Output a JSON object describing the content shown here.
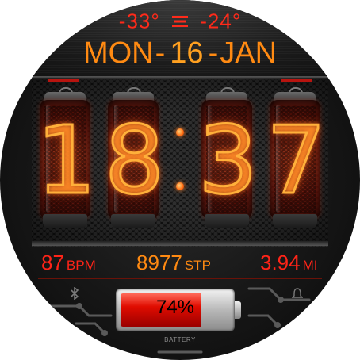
{
  "weather": {
    "temp_low": "-33°",
    "temp_high": "-24°",
    "icon": "wind-icon",
    "color": "#ff2a1a"
  },
  "date": {
    "weekday": "MON",
    "day": "16",
    "month": "JAN",
    "separator": "-",
    "color": "#ff8a12"
  },
  "time": {
    "digits": [
      "1",
      "8",
      "3",
      "7"
    ],
    "digit_color": "#ffb03a"
  },
  "stats": {
    "heart_rate": {
      "value": "87",
      "unit": "BPM",
      "color": "#ff2418"
    },
    "steps": {
      "value": "8977",
      "unit": "STP",
      "color": "#ff8a12"
    },
    "distance": {
      "value": "3.94",
      "unit": "MI",
      "color": "#ff2418"
    }
  },
  "battery": {
    "percent_text": "74%",
    "level": 0.74,
    "label": "BATTERY",
    "fill_color": "#e00c00"
  },
  "bottom_icons": [
    "bluetooth-icon",
    "alarm-icon"
  ]
}
